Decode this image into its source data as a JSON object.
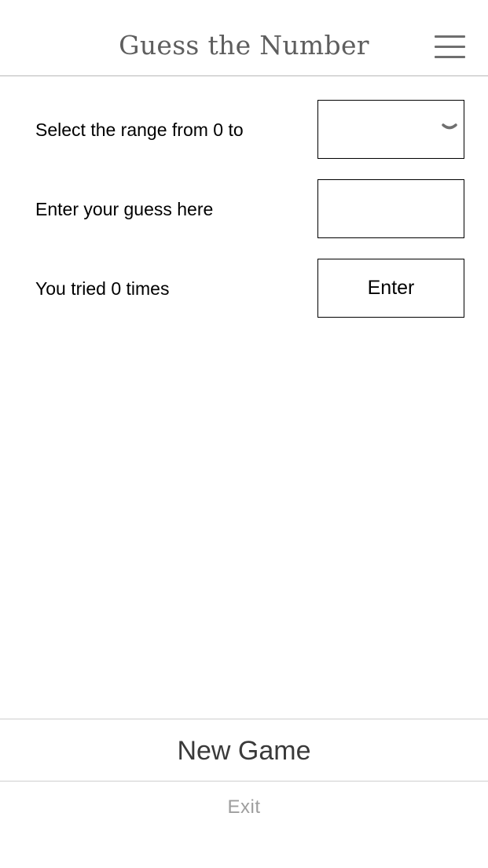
{
  "header": {
    "title": "Guess the Number",
    "menu_icon": "hamburger-menu-icon"
  },
  "form": {
    "range_label": "Select the range from 0 to",
    "range_selected": "",
    "range_chevron_icon": "chevron-down-icon",
    "guess_label": "Enter your guess here",
    "guess_value": "",
    "guess_placeholder": "",
    "tries_label": "You tried 0 times",
    "enter_label": "Enter"
  },
  "footer": {
    "new_game_label": "New Game",
    "exit_label": "Exit"
  },
  "colors": {
    "title": "#5e5e5e",
    "menu_icon": "#6f6f6f",
    "border": "#000000",
    "new_game": "#3a3a3a",
    "exit": "#9e9e9e"
  }
}
